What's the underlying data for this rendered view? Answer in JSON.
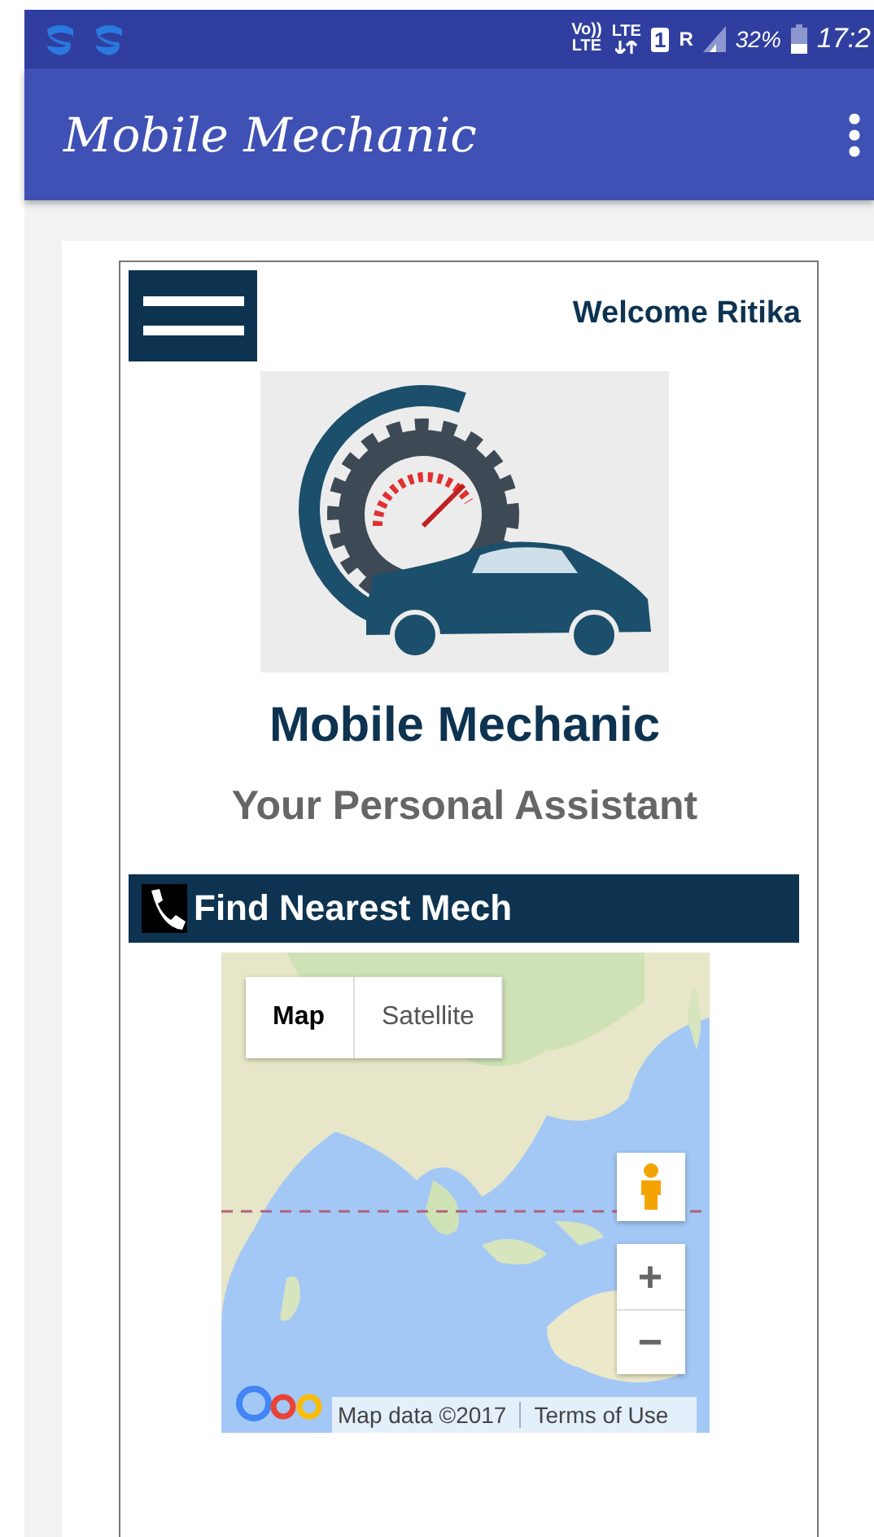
{
  "status_bar": {
    "volte": [
      "Vo))",
      "LTE"
    ],
    "network": "LTE",
    "sim": "1",
    "roaming": "R",
    "battery": "32%",
    "time": "17:2"
  },
  "app_bar": {
    "title": "Mobile Mechanic"
  },
  "header": {
    "welcome": "Welcome Ritika"
  },
  "title": "Mobile Mechanic",
  "subtitle": "Your Personal Assistant",
  "section": {
    "label": "Find Nearest Mech"
  },
  "map": {
    "kind": "picture",
    "types": [
      {
        "label": "Map",
        "selected": true
      },
      {
        "label": "Satellite",
        "selected": false
      }
    ],
    "zoom": [
      "+",
      "−"
    ],
    "attribution": "Map data ©2017",
    "terms": "Terms of Use"
  }
}
